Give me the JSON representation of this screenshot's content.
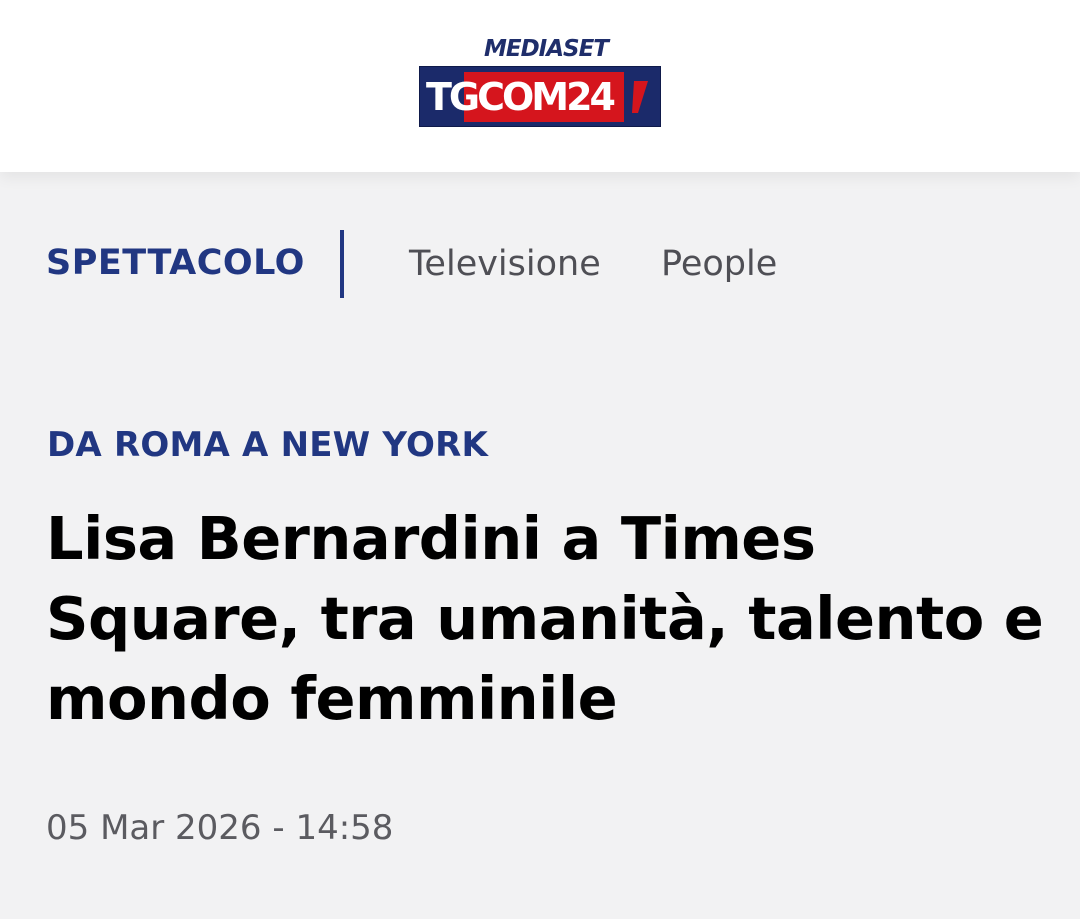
{
  "header": {
    "logo": {
      "top_text": "MEDIASET",
      "main_text": "TGCOM24",
      "colors": {
        "navy": "#1b2a6a",
        "red": "#d5151d"
      }
    }
  },
  "nav": {
    "section": "SPETTACOLO",
    "links": [
      "Televisione",
      "People"
    ]
  },
  "article": {
    "kicker": "DA ROMA A NEW YORK",
    "title": "Lisa Bernardini a Times Square, tra umanità, talento e mondo femminile",
    "datetime": "05 Mar 2026 - 14:58"
  },
  "colors": {
    "accent": "#213782",
    "background": "#f2f2f3",
    "header_bg": "#ffffff",
    "text": "#000000",
    "muted": "#5b5b60"
  }
}
